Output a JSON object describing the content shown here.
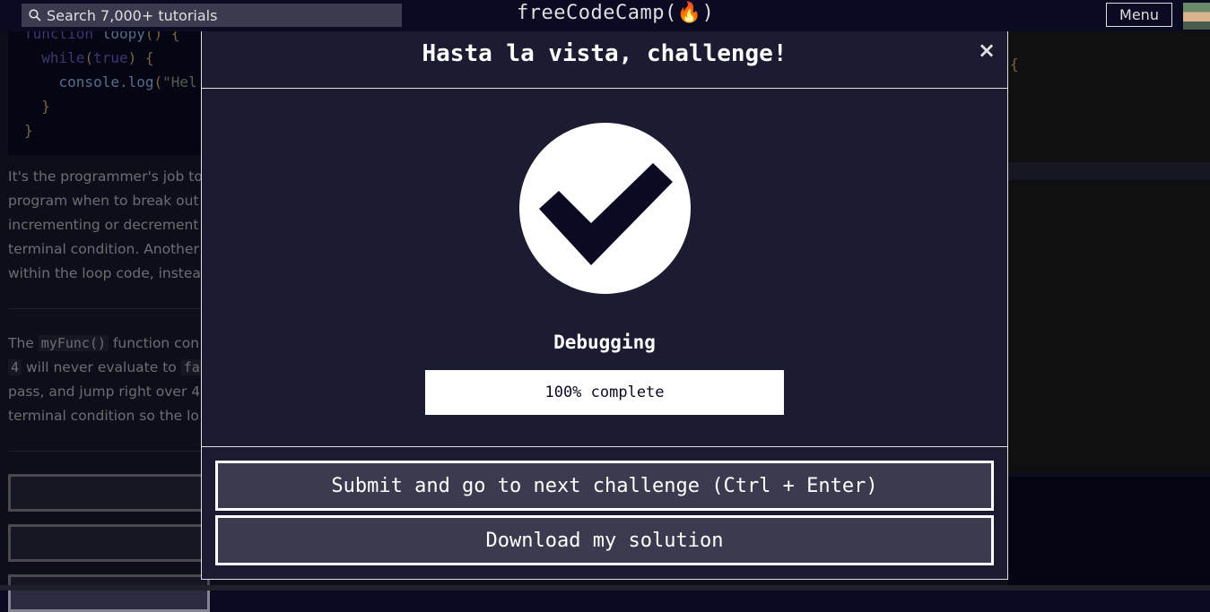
{
  "navbar": {
    "search_placeholder": "Search 7,000+ tutorials",
    "brand": "freeCodeCamp(🔥)",
    "menu_label": "Menu"
  },
  "background": {
    "code_lines": [
      {
        "parts": [
          [
            "kw",
            "function "
          ],
          [
            "fn",
            "loopy"
          ],
          [
            "br",
            "() {"
          ]
        ]
      },
      {
        "parts": [
          [
            "kw",
            "  while"
          ],
          [
            "br",
            "("
          ],
          [
            "kw",
            "true"
          ],
          [
            "br",
            ") {"
          ]
        ]
      },
      {
        "parts": [
          [
            "fn",
            "    console"
          ],
          [
            "br",
            "."
          ],
          [
            "fn",
            "log"
          ],
          [
            "br",
            "("
          ],
          [
            "str",
            "\"Hel"
          ]
        ]
      },
      {
        "parts": [
          [
            "br",
            "  }"
          ]
        ]
      },
      {
        "parts": [
          [
            "br",
            "}"
          ]
        ]
      }
    ],
    "para1": [
      "It's the programmer's job to",
      "program when to break out",
      "incrementing or decrement",
      "terminal condition. Another",
      "within the loop code, instea"
    ],
    "para2_line1_a": "The ",
    "para2_line1_code": "myFunc()",
    "para2_line1_b": " function con",
    "para2_line2_code": "4",
    "para2_line2_b": " will never evaluate to ",
    "para2_line2_code2": "fal",
    "para2_line3": "pass, and jump right over 4 s",
    "para2_line4": "terminal condition so the lo",
    "editor_brace": "{"
  },
  "modal": {
    "title": "Hasta la vista, challenge!",
    "close_label": "×",
    "block_name": "Debugging",
    "progress_percent": 100,
    "progress_text": "100% complete",
    "submit_label": "Submit and go to next challenge (Ctrl + Enter)",
    "download_label": "Download my solution"
  },
  "colors": {
    "background": "#0a0a23",
    "modal_bg": "#1b1b32",
    "button_bg": "#3b3b4f",
    "check_fg": "#0a0a23"
  }
}
